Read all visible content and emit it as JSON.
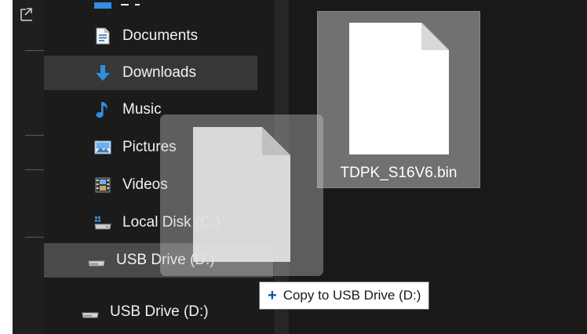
{
  "nav": {
    "items": [
      {
        "label": "Documents",
        "icon": "documents-icon"
      },
      {
        "label": "Downloads",
        "icon": "downloads-icon"
      },
      {
        "label": "Music",
        "icon": "music-icon"
      },
      {
        "label": "Pictures",
        "icon": "pictures-icon"
      },
      {
        "label": "Videos",
        "icon": "videos-icon"
      },
      {
        "label": "Local Disk (C:)",
        "icon": "local-disk-icon"
      },
      {
        "label": "USB Drive (D:)",
        "icon": "usb-drive-icon"
      }
    ],
    "extra_drive": {
      "label": "USB Drive (D:)",
      "icon": "usb-drive-icon"
    }
  },
  "content": {
    "file": {
      "name": "TDPK_S16V6.bin",
      "icon": "file-icon"
    }
  },
  "drag": {
    "tooltip": "Copy to USB Drive (D:)",
    "tooltip_symbol": "+"
  },
  "colors": {
    "background": "#191919",
    "selected_tile": "#717171",
    "hover_row": "#373737",
    "drop_target_row": "#4a4a4a",
    "text": "#f2f2f2",
    "tooltip_plus": "#0b4fb4"
  }
}
